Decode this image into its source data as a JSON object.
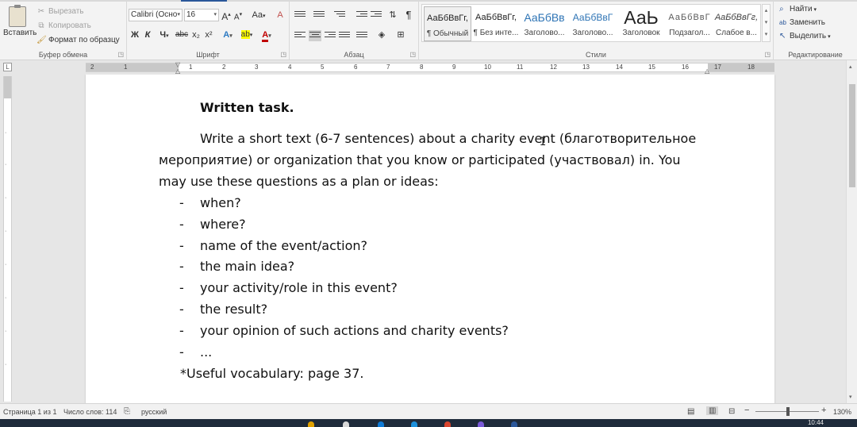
{
  "ribbon": {
    "clipboard": {
      "paste": "Вставить",
      "cut": "Вырезать",
      "copy": "Копировать",
      "format_painter": "Формат по образцу",
      "label": "Буфер обмена"
    },
    "font": {
      "family": "Calibri (Осно",
      "size": "16",
      "grow": "A",
      "shrink": "A",
      "case": "Aa",
      "clear": "A",
      "bold": "Ж",
      "italic": "К",
      "underline": "Ч",
      "strike": "abc",
      "subscript": "x₂",
      "superscript": "x²",
      "effects": "A",
      "highlight": "ab",
      "color": "A",
      "label": "Шрифт"
    },
    "paragraph": {
      "pilcrow": "¶",
      "label": "Абзац"
    },
    "styles": {
      "label": "Стили",
      "items": [
        {
          "preview": "АаБбВвГг,",
          "name": "¶ Обычный"
        },
        {
          "preview": "АаБбВвГг,",
          "name": "¶ Без инте..."
        },
        {
          "preview": "АаБбВв",
          "name": "Заголово..."
        },
        {
          "preview": "АаБбВвГ",
          "name": "Заголово..."
        },
        {
          "preview": "АаЬ",
          "name": "Заголовок"
        },
        {
          "preview": "АаБбВвГ",
          "name": "Подзагол..."
        },
        {
          "preview": "АаБбВвГг,",
          "name": "Слабое в..."
        }
      ]
    },
    "editing": {
      "find": "Найти",
      "replace": "Заменить",
      "select": "Выделить",
      "label": "Редактирование"
    }
  },
  "ruler": {
    "numbers": [
      "2",
      "1",
      "1",
      "2",
      "3",
      "4",
      "5",
      "6",
      "7",
      "8",
      "9",
      "10",
      "11",
      "12",
      "13",
      "14",
      "15",
      "16",
      "17",
      "18"
    ]
  },
  "document": {
    "title": "Written task.",
    "para_line1": "Write a short text (6-7 sentences) about a charity event (благотворительное",
    "para_line2": "мероприятие) or organization that you know or participated (участвовал) in. You",
    "para_line3": "may use these questions as a plan or ideas:",
    "bullets": [
      "when?",
      "where?",
      "name of the event/action?",
      "the main idea?",
      "your activity/role in this event?",
      "the result?",
      "your opinion of such actions and charity events?",
      "..."
    ],
    "vocab": "*Useful vocabulary: page 37."
  },
  "status": {
    "page": "Страница 1 из 1",
    "words": "Число слов: 114",
    "language": "русский",
    "zoom": "130%"
  },
  "taskbar": {
    "time": "10:44"
  },
  "colors": {
    "accent": "#2b579a",
    "highlight": "#ffff00",
    "font_color": "#c00000"
  }
}
